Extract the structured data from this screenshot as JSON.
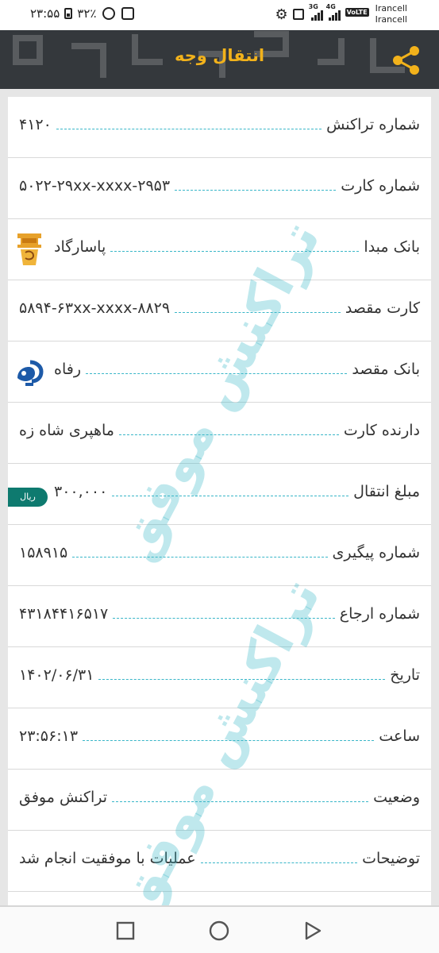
{
  "status_bar": {
    "time": "۲۳:۵۵",
    "battery": "۳۲٪",
    "network_type": "4G",
    "carrier_1": "Irancell",
    "carrier_2": "Irancell",
    "volte": "VoLTE",
    "signal_tag": "3G"
  },
  "header": {
    "title": "انتقال وجه",
    "accent_color": "#f2b21b"
  },
  "details": [
    {
      "label": "شماره تراکنش",
      "value": "۴۱۲۰"
    },
    {
      "label": "شماره کارت",
      "value": "۵۰۲۲-۲۹xx-xxxx-۲۹۵۳"
    },
    {
      "label": "بانک مبدا",
      "value": "پاسارگاد",
      "icon": "pasargad-bank-logo-icon"
    },
    {
      "label": "کارت مقصد",
      "value": "۵۸۹۴-۶۳xx-xxxx-۸۸۲۹"
    },
    {
      "label": "بانک مقصد",
      "value": "رفاه",
      "icon": "refah-bank-logo-icon"
    },
    {
      "label": "دارنده کارت",
      "value": "ماهپری شاه زه"
    },
    {
      "label": "مبلغ انتقال",
      "value": "۳۰۰,۰۰۰",
      "badge": "ریال"
    },
    {
      "label": "شماره پیگیری",
      "value": "۱۵۸۹۱۵"
    },
    {
      "label": "شماره ارجاع",
      "value": "۴۳۱۸۴۴۱۶۵۱۷"
    },
    {
      "label": "تاریخ",
      "value": "۱۴۰۲/۰۶/۳۱"
    },
    {
      "label": "ساعت",
      "value": "۲۳:۵۶:۱۳"
    },
    {
      "label": "وضعیت",
      "value": "تراکنش موفق"
    },
    {
      "label": "توضیحات",
      "value": "عملیات با موفقیت انجام شد"
    }
  ],
  "watermark": "تراکنش موفق",
  "colors": {
    "dotted_leader": "#39b6c8",
    "riyal_badge": "#0e7a6f"
  }
}
